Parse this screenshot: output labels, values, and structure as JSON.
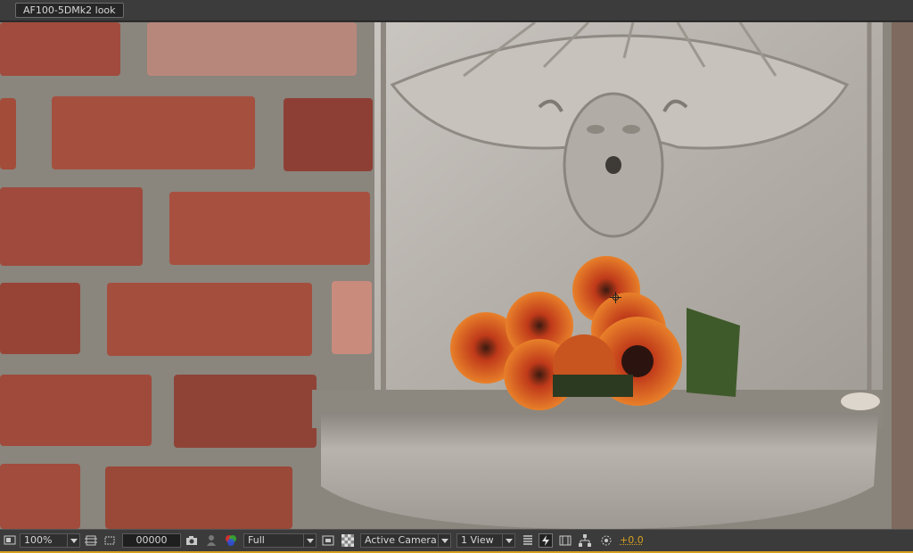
{
  "composition": {
    "tab_label": "AF100-5DMk2 look"
  },
  "viewer": {
    "image_description_icon": "crosshair-icon"
  },
  "toolbar": {
    "zoom": "100%",
    "timecode": "00000",
    "resolution": "Full",
    "view": "Active Camera",
    "layout": "1 View",
    "exposure": "+0.0",
    "icons": [
      "monitor-icon",
      "grid-icon",
      "mask-icon",
      "camera-icon",
      "snapshot-user-icon",
      "channel-icon",
      "region-icon",
      "transparency-icon",
      "layers-icon",
      "fast-preview-icon",
      "flowchart-icon",
      "reset-exposure-icon"
    ]
  },
  "colors": {
    "accent": "#d4a020",
    "panel": "#3b3b3b"
  }
}
